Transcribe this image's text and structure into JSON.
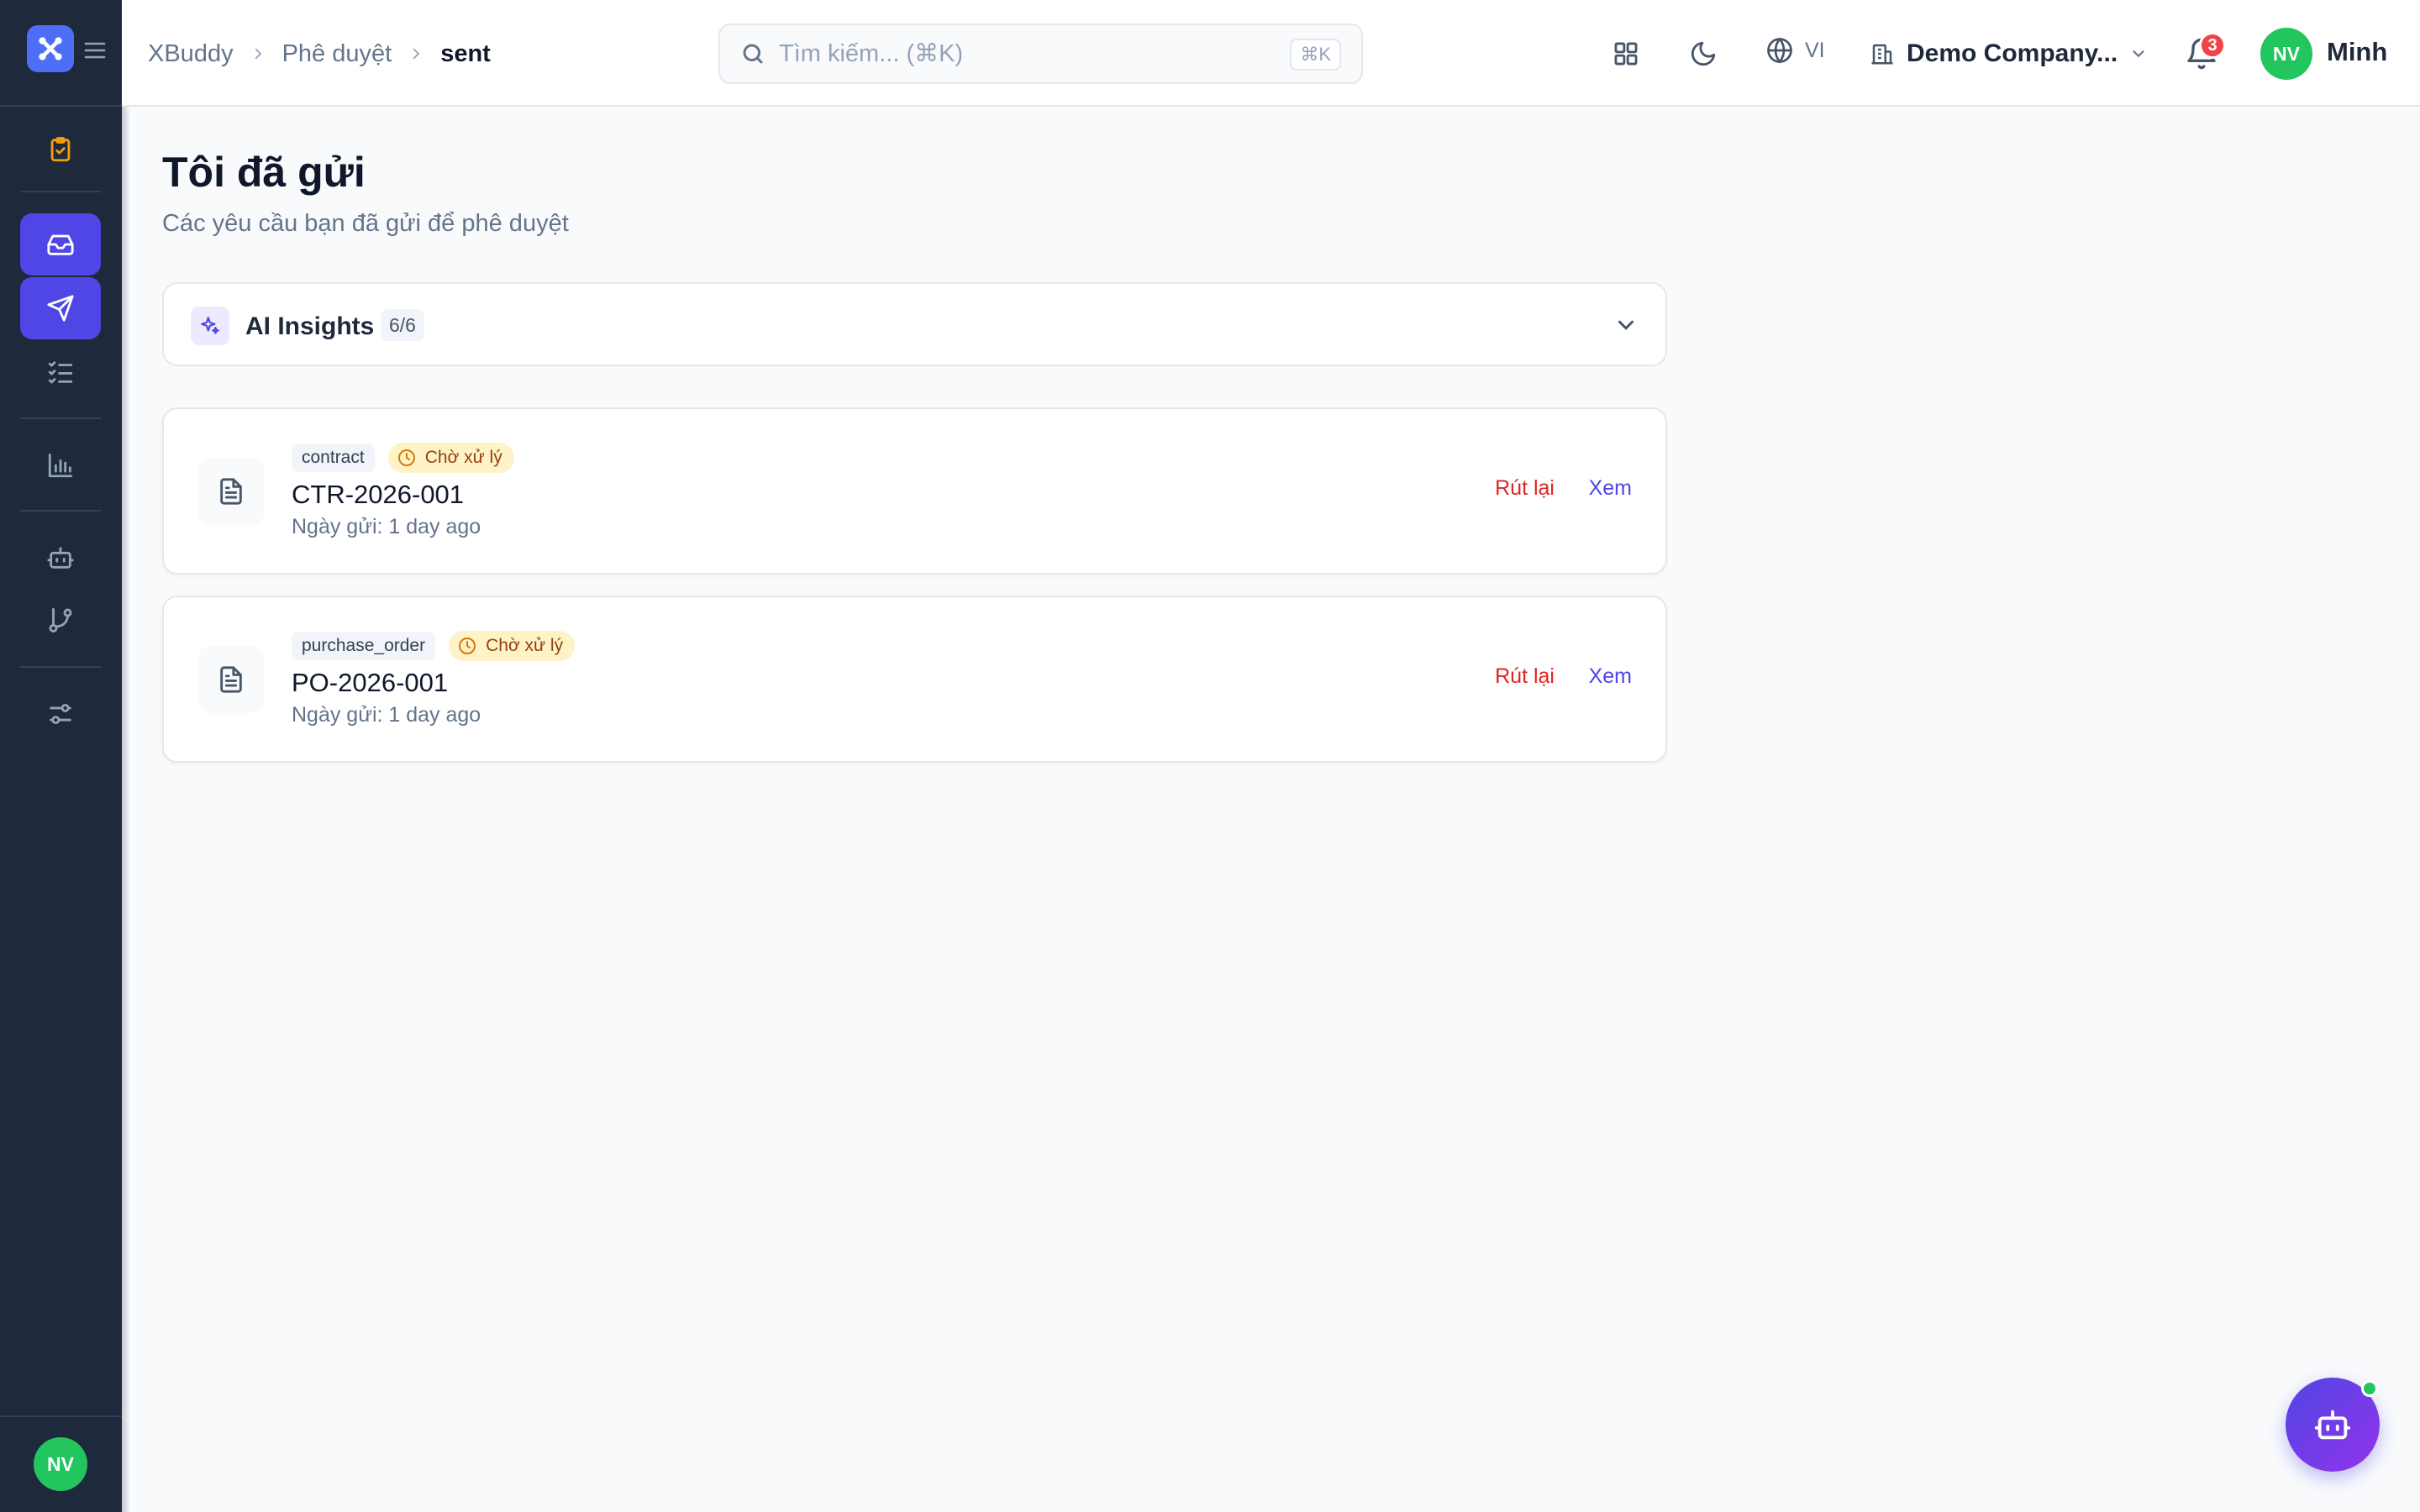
{
  "brand": {
    "accent": "#4f46e5",
    "logo_color": "#4f6ef7",
    "sidebar_bg": "#1e293b"
  },
  "sidebar": {
    "items": [
      {
        "icon": "clipboard-check-icon",
        "active": false,
        "color": "#f59e0b"
      },
      {
        "icon": "inbox-icon",
        "active": true
      },
      {
        "icon": "send-icon",
        "active": true
      },
      {
        "icon": "list-checks-icon",
        "active": false
      },
      {
        "icon": "bar-chart-icon",
        "active": false
      },
      {
        "icon": "bot-icon",
        "active": false
      },
      {
        "icon": "git-branch-icon",
        "active": false
      },
      {
        "icon": "sliders-icon",
        "active": false
      }
    ],
    "avatar_initials": "NV"
  },
  "header": {
    "breadcrumb": [
      "XBuddy",
      "Phê duyệt",
      "sent"
    ],
    "search": {
      "placeholder": "Tìm kiếm... (⌘K)",
      "shortcut": "⌘K"
    },
    "language": "VI",
    "company": "Demo Company...",
    "notifications": "3",
    "user": {
      "initials": "NV",
      "name": "Minh"
    }
  },
  "main": {
    "title": "Tôi đã gửi",
    "subtitle": "Các yêu cầu bạn đã gửi để phê duyệt",
    "insights": {
      "title": "AI Insights",
      "count": "6/6"
    },
    "requests": [
      {
        "type": "contract",
        "status": "Chờ xử lý",
        "code": "CTR-2026-001",
        "date": "Ngày gửi: 1 day ago",
        "withdraw_label": "Rút lại",
        "view_label": "Xem"
      },
      {
        "type": "purchase_order",
        "status": "Chờ xử lý",
        "code": "PO-2026-001",
        "date": "Ngày gửi: 1 day ago",
        "withdraw_label": "Rút lại",
        "view_label": "Xem"
      }
    ]
  }
}
